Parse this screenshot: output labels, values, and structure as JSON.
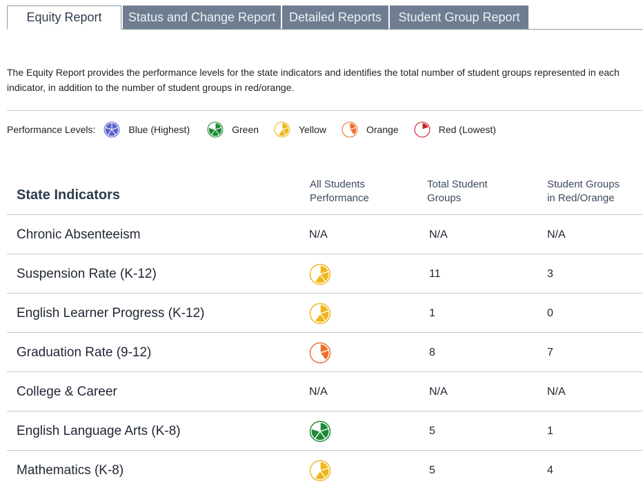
{
  "tabs": [
    {
      "label": "Equity Report",
      "active": true
    },
    {
      "label": "Status and Change Report",
      "active": false
    },
    {
      "label": "Detailed Reports",
      "active": false
    },
    {
      "label": "Student Group Report",
      "active": false
    }
  ],
  "intro": {
    "line1": "The Equity Report provides the performance levels for the state indicators and identifies the total number of student groups represented in each",
    "line2": "indicator, in addition to the number of student groups in red/orange."
  },
  "legend": {
    "title": "Performance Levels:",
    "items": [
      {
        "label": "Blue (Highest)",
        "level": "blue"
      },
      {
        "label": "Green",
        "level": "green"
      },
      {
        "label": "Yellow",
        "level": "yellow"
      },
      {
        "label": "Orange",
        "level": "orange"
      },
      {
        "label": "Red (Lowest)",
        "level": "red"
      }
    ]
  },
  "colors": {
    "blue": "#5b62c9",
    "green": "#1e8a35",
    "yellow": "#f1b51c",
    "orange": "#ee6f2c",
    "red": "#c8202a",
    "tab_inactive": "#6e7e90",
    "heading": "#2d3a4e"
  },
  "table": {
    "headers": {
      "indicator": "State Indicators",
      "all_students_line1": "All Students",
      "all_students_line2": "Performance",
      "total_groups_line1": "Total Student",
      "total_groups_line2": "Groups",
      "red_orange_line1": "Student Groups",
      "red_orange_line2": "in Red/Orange"
    },
    "rows": [
      {
        "indicator": "Chronic Absenteeism",
        "performance": "N/A",
        "level": null,
        "total": "N/A",
        "red_orange": "N/A"
      },
      {
        "indicator": "Suspension Rate (K-12)",
        "performance": null,
        "level": "yellow",
        "total": "11",
        "red_orange": "3"
      },
      {
        "indicator": "English Learner Progress (K-12)",
        "performance": null,
        "level": "yellow",
        "total": "1",
        "red_orange": "0"
      },
      {
        "indicator": "Graduation Rate (9-12)",
        "performance": null,
        "level": "orange",
        "total": "8",
        "red_orange": "7"
      },
      {
        "indicator": "College & Career",
        "performance": "N/A",
        "level": null,
        "total": "N/A",
        "red_orange": "N/A"
      },
      {
        "indicator": "English Language Arts (K-8)",
        "performance": null,
        "level": "green",
        "total": "5",
        "red_orange": "1"
      },
      {
        "indicator": "Mathematics (K-8)",
        "performance": null,
        "level": "yellow",
        "total": "5",
        "red_orange": "4"
      }
    ]
  }
}
